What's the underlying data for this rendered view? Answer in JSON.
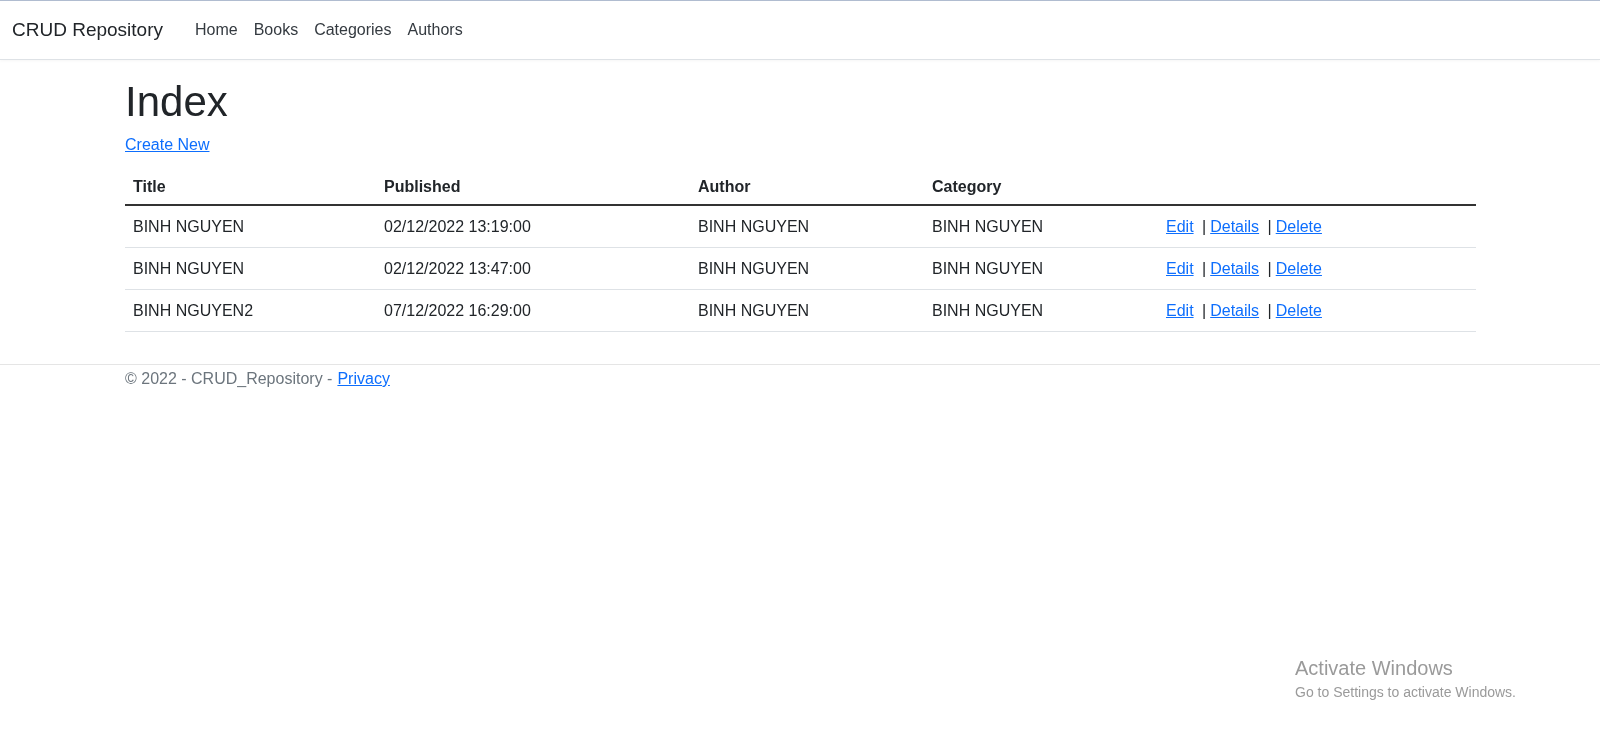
{
  "navbar": {
    "brand": "CRUD Repository",
    "links": [
      {
        "label": "Home"
      },
      {
        "label": "Books"
      },
      {
        "label": "Categories"
      },
      {
        "label": "Authors"
      }
    ]
  },
  "heading": "Index",
  "create_link": "Create New",
  "table": {
    "columns": [
      "Title",
      "Published",
      "Author",
      "Category"
    ],
    "rows": [
      {
        "cells": [
          "BINH NGUYEN",
          "02/12/2022 13:19:00",
          "BINH NGUYEN",
          "BINH NGUYEN"
        ],
        "actions": [
          "Edit",
          "Details",
          "Delete"
        ],
        "separators": [
          "|",
          "|"
        ]
      },
      {
        "cells": [
          "BINH NGUYEN",
          "02/12/2022 13:47:00",
          "BINH NGUYEN",
          "BINH NGUYEN"
        ],
        "actions": [
          "Edit",
          "Details",
          "Delete"
        ],
        "separators": [
          "|",
          "|"
        ]
      },
      {
        "cells": [
          "BINH NGUYEN2",
          "07/12/2022 16:29:00",
          "BINH NGUYEN",
          "BINH NGUYEN"
        ],
        "actions": [
          "Edit",
          "Details",
          "Delete"
        ],
        "separators": [
          "|",
          "|"
        ]
      }
    ]
  },
  "footer": {
    "text": "© 2022 - CRUD_Repository -",
    "link": "Privacy"
  },
  "os_notice": {
    "title": "Activate Windows",
    "subtitle": "Go to Settings to activate Windows."
  }
}
